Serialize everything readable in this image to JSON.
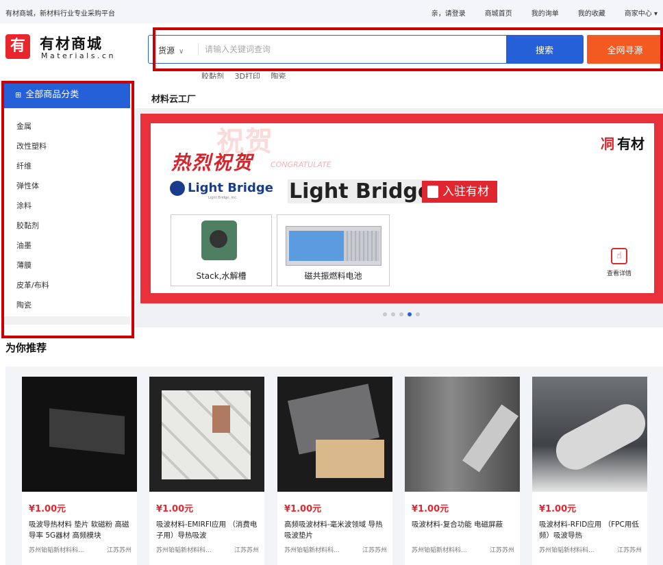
{
  "topbar": {
    "slogan": "有材商城，新材料行业专业采购平台",
    "links": [
      "亲，请登录",
      "商城首页",
      "我的询单",
      "我的收藏",
      "商家中心 ▾"
    ]
  },
  "logo": {
    "mark": "有",
    "name": "有材商城",
    "domain": "Materials.cn"
  },
  "search": {
    "scope": "货源",
    "placeholder": "请输入关键词查询",
    "search_button": "搜索",
    "all_button": "全网寻源",
    "hot_words": [
      "胶黏剂",
      "3D打印",
      "陶瓷"
    ]
  },
  "subnav": {
    "label": "材料云工厂"
  },
  "categories": {
    "header": "全部商品分类",
    "items": [
      "金属",
      "改性塑料",
      "纤维",
      "弹性体",
      "涂料",
      "胶黏剂",
      "油墨",
      "薄膜",
      "皮革/布料",
      "陶瓷"
    ]
  },
  "banner": {
    "watermark": "祝贺",
    "headline": "热烈祝贺",
    "headline_en": "CONGRATULATE",
    "brand": "有材",
    "partner_logo": "Light Bridge",
    "partner_logo_sub": "Light Bridge, Inc.",
    "partner_name": "Light Bridge",
    "join_text": "入驻有材",
    "product1": "Stack,水解槽",
    "product2": "磁共振燃料电池",
    "detail": "查看详情",
    "active_slide": 4,
    "slide_count": 5
  },
  "recommend": {
    "title": "为你推荐",
    "items": [
      {
        "price": "¥1.00元",
        "title": "吸波导热材料 垫片 软磁粉 高磁导率 5G器材 高频模块",
        "shop": "苏州铂韬新材料科...",
        "loc": "江苏苏州"
      },
      {
        "price": "¥1.00元",
        "title": "吸波材料-EMIRFI应用 （消费电子用）导热吸波",
        "shop": "苏州铂韬新材料科...",
        "loc": "江苏苏州"
      },
      {
        "price": "¥1.00元",
        "title": "高频吸波材料-毫米波领域 导热吸波垫片",
        "shop": "苏州铂韬新材料科...",
        "loc": "江苏苏州"
      },
      {
        "price": "¥1.00元",
        "title": "吸波材料-复合功能 电磁屏蔽",
        "shop": "苏州铂韬新材料科...",
        "loc": "江苏苏州"
      },
      {
        "price": "¥1.00元",
        "title": "吸波材料-RFID应用 （FPC用低频）吸波导热",
        "shop": "苏州铂韬新材料科...",
        "loc": "江苏苏州"
      }
    ]
  },
  "colors": {
    "brand_red": "#e8262e",
    "primary_blue": "#2560d8",
    "accent_orange": "#f35a21",
    "highlight_red": "#c00000"
  }
}
